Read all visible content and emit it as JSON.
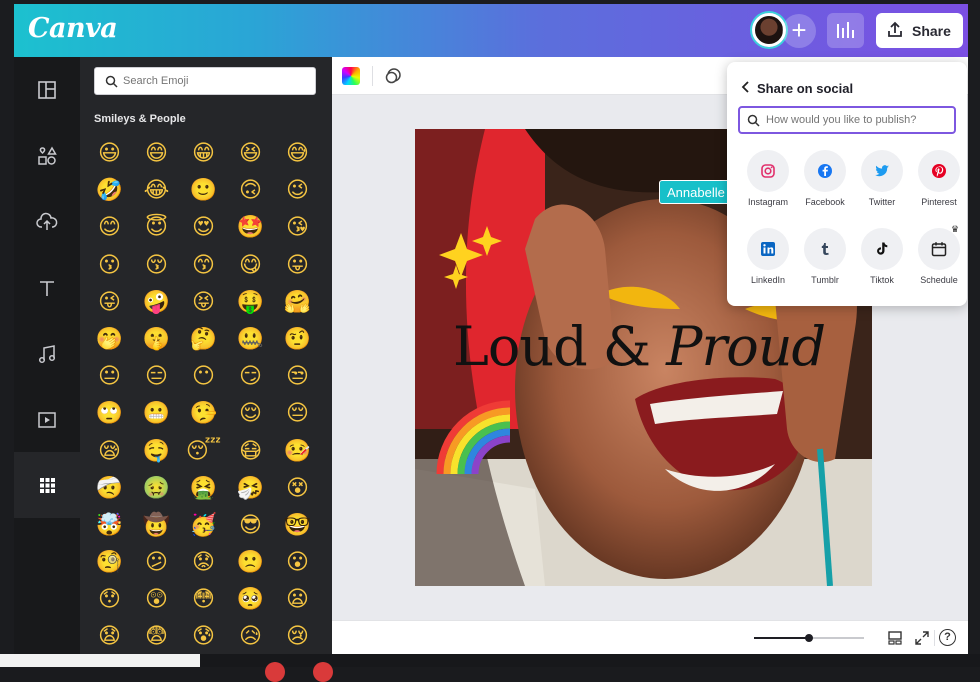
{
  "app": {
    "logo": "Canva",
    "share_label": "Share",
    "plus_label": "+",
    "brand_colors": {
      "gradient_start": "#1cc1cf",
      "gradient_end": "#7b4fe3",
      "accent": "#7d57e0",
      "collaborator": "#17c0c9"
    }
  },
  "sidebar": {
    "items": [
      {
        "name": "design",
        "icon": "layout-icon"
      },
      {
        "name": "elements",
        "icon": "shapes-icon"
      },
      {
        "name": "uploads",
        "icon": "cloud-upload-icon"
      },
      {
        "name": "text",
        "icon": "text-icon"
      },
      {
        "name": "audio",
        "icon": "music-note-icon"
      },
      {
        "name": "videos",
        "icon": "play-icon"
      },
      {
        "name": "apps",
        "icon": "grid-icon",
        "active": true
      }
    ]
  },
  "emoji_panel": {
    "search_placeholder": "Search Emoji",
    "section_title": "Smileys & People",
    "emojis": [
      "😃",
      "😄",
      "😁",
      "😆",
      "😅",
      "🤣",
      "😂",
      "🙂",
      "🙃",
      "😉",
      "😊",
      "😇",
      "😍",
      "🤩",
      "😘",
      "😗",
      "😚",
      "😙",
      "😋",
      "😛",
      "😜",
      "🤪",
      "😝",
      "🤑",
      "🤗",
      "🤭",
      "🤫",
      "🤔",
      "🤐",
      "🤨",
      "😐",
      "😑",
      "😶",
      "😏",
      "😒",
      "🙄",
      "😬",
      "🤥",
      "😌",
      "😔",
      "😪",
      "🤤",
      "😴",
      "😷",
      "🤒",
      "🤕",
      "🤢",
      "🤮",
      "🤧",
      "😵",
      "🤯",
      "🤠",
      "🥳",
      "😎",
      "🤓",
      "🧐",
      "😕",
      "😟",
      "🙁",
      "😮",
      "😯",
      "😲",
      "😳",
      "🥺",
      "😦",
      "😧",
      "😨",
      "😰",
      "😥",
      "😢"
    ]
  },
  "design": {
    "headline_left": "Loud & ",
    "headline_right": "Proud"
  },
  "collaborator": {
    "name": "Annabelle"
  },
  "share_popover": {
    "title": "Share on social",
    "search_placeholder": "How would you like to publish?",
    "options": [
      {
        "label": "Instagram",
        "icon": "instagram-icon",
        "color": "#e1306c"
      },
      {
        "label": "Facebook",
        "icon": "facebook-icon",
        "color": "#1877f2"
      },
      {
        "label": "Twitter",
        "icon": "twitter-icon",
        "color": "#1d9bf0"
      },
      {
        "label": "Pinterest",
        "icon": "pinterest-icon",
        "color": "#e60023"
      },
      {
        "label": "LinkedIn",
        "icon": "linkedin-icon",
        "color": "#0a66c2"
      },
      {
        "label": "Tumblr",
        "icon": "tumblr-icon",
        "color": "#35465c"
      },
      {
        "label": "Tiktok",
        "icon": "tiktok-icon",
        "color": "#111111"
      },
      {
        "label": "Schedule",
        "icon": "calendar-icon",
        "color": "#222222"
      }
    ]
  },
  "footer": {
    "zoom_fraction": 0.5,
    "help_label": "?"
  }
}
